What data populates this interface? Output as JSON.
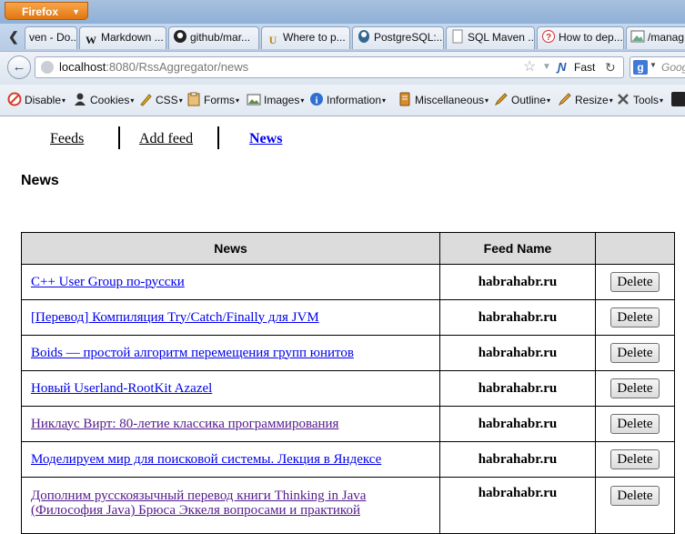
{
  "browser": {
    "app_button": "Firefox",
    "tabs": [
      {
        "label": "ven - Do...",
        "icon": "page-icon"
      },
      {
        "label": "Markdown ...",
        "icon": "wikipedia-icon"
      },
      {
        "label": "github/mar...",
        "icon": "github-icon"
      },
      {
        "label": "Where to p...",
        "icon": "horseshoe-icon"
      },
      {
        "label": "PostgreSQL:...",
        "icon": "postgres-icon"
      },
      {
        "label": "SQL Maven ...",
        "icon": "blank-page-icon"
      },
      {
        "label": "How to dep...",
        "icon": "help-icon"
      },
      {
        "label": "/manag",
        "icon": "image-icon"
      }
    ],
    "url_host": "localhost",
    "url_rest": ":8080/RssAggregator/news",
    "fast_label": "Fast",
    "search_placeholder": "Goog"
  },
  "devtoolbar": {
    "items": [
      {
        "label": "Disable",
        "icon": "disable-icon",
        "color": "#d83b2b"
      },
      {
        "label": "Cookies",
        "icon": "cookies-icon",
        "color": "#4a4a4a"
      },
      {
        "label": "CSS",
        "icon": "css-icon",
        "color": "#e0b21e"
      },
      {
        "label": "Forms",
        "icon": "forms-icon",
        "color": "#c98a2a"
      },
      {
        "label": "Images",
        "icon": "images-icon",
        "color": "#5b8f3a"
      },
      {
        "label": "Information",
        "icon": "information-icon",
        "color": "#2e6fd0"
      },
      {
        "label": "Miscellaneous",
        "icon": "miscellaneous-icon",
        "color": "#c9781e"
      },
      {
        "label": "Outline",
        "icon": "outline-icon",
        "color": "#d8a21e"
      },
      {
        "label": "Resize",
        "icon": "resize-icon",
        "color": "#d7a01c"
      },
      {
        "label": "Tools",
        "icon": "tools-icon",
        "color": "#6a6a6a"
      }
    ]
  },
  "page": {
    "nav": {
      "feeds": "Feeds",
      "add_feed": "Add feed",
      "news": "News"
    },
    "title": "News",
    "table": {
      "headers": {
        "news": "News",
        "feed_name": "Feed Name",
        "action": ""
      },
      "delete_label": "Delete",
      "rows": [
        {
          "title": "C++ User Group по-русски",
          "feed": "habrahabr.ru",
          "visited": false
        },
        {
          "title": "[Перевод] Компиляция Try/Catch/Finally для JVM",
          "feed": "habrahabr.ru",
          "visited": false
        },
        {
          "title": "Boids — простой алгоритм перемещения групп юнитов",
          "feed": "habrahabr.ru",
          "visited": false
        },
        {
          "title": "Новый Userland-RootKit Azazel",
          "feed": "habrahabr.ru",
          "visited": false
        },
        {
          "title": "Никлаус Вирт: 80-летие классика программирования",
          "feed": "habrahabr.ru",
          "visited": true
        },
        {
          "title": "Моделируем мир для поисковой системы. Лекция в Яндексе",
          "feed": "habrahabr.ru",
          "visited": false
        },
        {
          "title": "Дополним русскоязычный перевод книги Thinking in Java (Философия Java) Брюса Эккеля вопросами и практикой",
          "feed": "habrahabr.ru",
          "visited": true
        }
      ]
    }
  }
}
